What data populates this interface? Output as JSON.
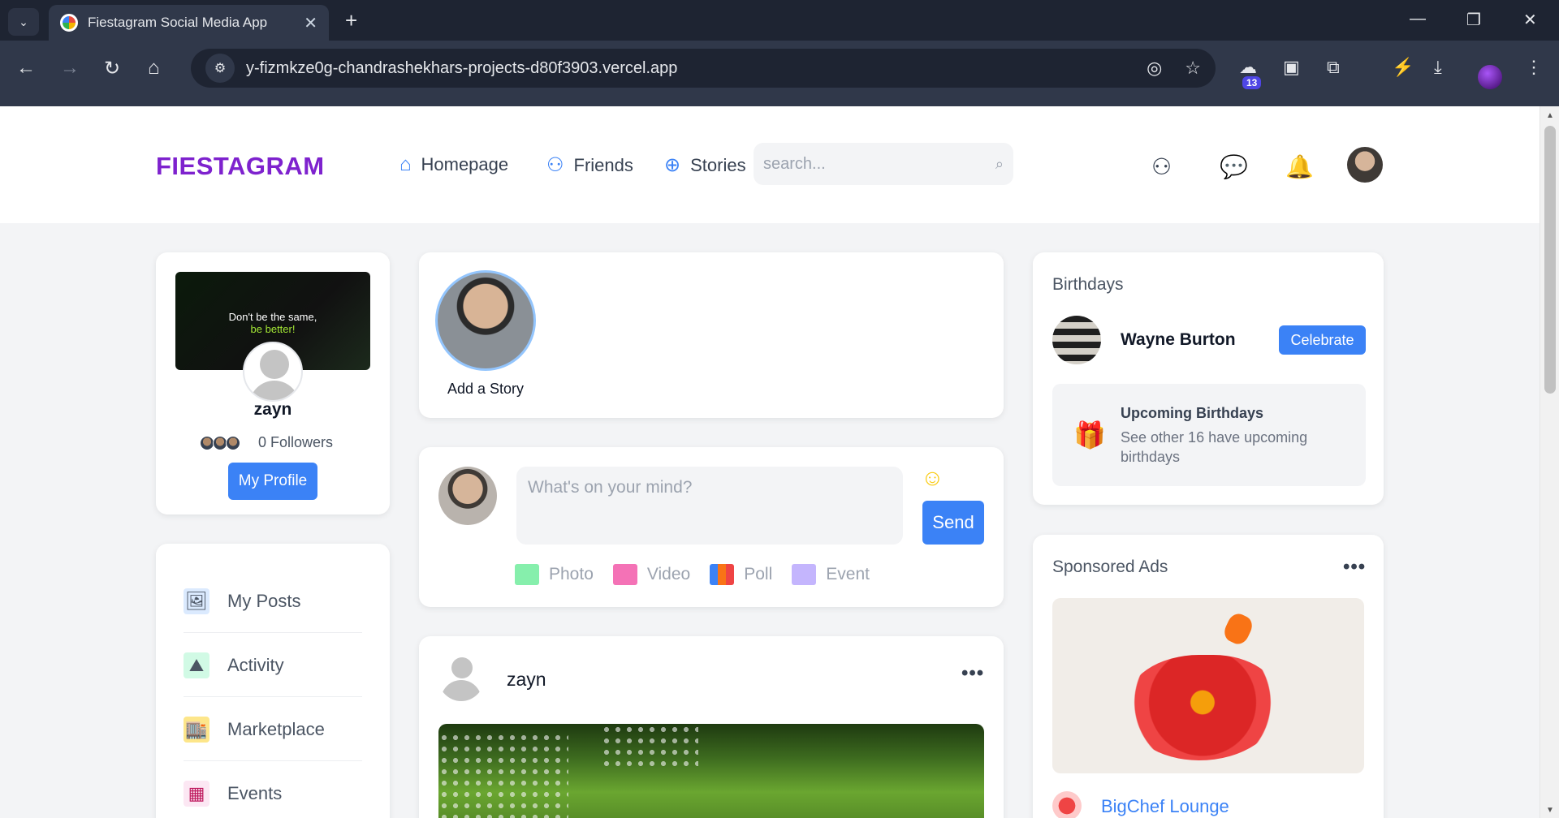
{
  "browser": {
    "tab_title": "Fiestagram Social Media App",
    "url": "y-fizmkze0g-chandrashekhars-projects-d80f3903.vercel.app",
    "extension_badge": "13"
  },
  "header": {
    "logo": "FIESTAGRAM",
    "nav": [
      {
        "label": "Homepage",
        "icon": "home-icon"
      },
      {
        "label": "Friends",
        "icon": "friends-icon"
      },
      {
        "label": "Stories",
        "icon": "plus-circle-icon"
      }
    ],
    "search_placeholder": "search..."
  },
  "profile": {
    "cover_line1": "Don't be the same,",
    "cover_line2": "be better!",
    "name": "zayn",
    "followers": "0 Followers",
    "button": "My Profile"
  },
  "menu": [
    {
      "label": "My Posts"
    },
    {
      "label": "Activity"
    },
    {
      "label": "Marketplace"
    },
    {
      "label": "Events"
    }
  ],
  "stories": {
    "add_label": "Add a Story"
  },
  "composer": {
    "placeholder": "What's on your mind?",
    "send": "Send",
    "options": [
      {
        "label": "Photo",
        "color": "#86efac"
      },
      {
        "label": "Video",
        "color": "#f472b6"
      },
      {
        "label": "Poll",
        "color": "#f97316"
      },
      {
        "label": "Event",
        "color": "#a78bfa"
      }
    ]
  },
  "post": {
    "author": "zayn"
  },
  "birthdays": {
    "title": "Birthdays",
    "person": "Wayne Burton",
    "button": "Celebrate",
    "upcoming_title": "Upcoming Birthdays",
    "upcoming_text": "See other 16 have upcoming birthdays"
  },
  "ads": {
    "title": "Sponsored Ads",
    "brand": "BigChef Lounge"
  },
  "colors": {
    "accent": "#3b82f6",
    "logo": "#7e22ce"
  }
}
